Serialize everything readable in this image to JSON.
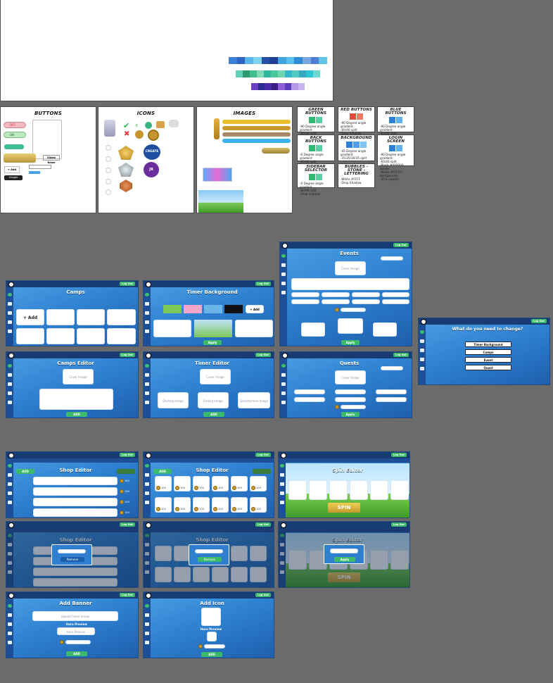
{
  "colors": {
    "canvas": "#6b6b6b",
    "palette_row1": [
      "#3a7fd8",
      "#2f63c4",
      "#5ab6e8",
      "#7fd2f0",
      "#2a4fa8",
      "#1e3f96",
      "#3fa3dd",
      "#56c0ee",
      "#2f8bd6",
      "#7aa5e0",
      "#4f7ed6",
      "#5fc4e6"
    ],
    "palette_row2": [
      "#5ed1b8",
      "#2e9a6e",
      "#3fbf8f",
      "#7fdcb4",
      "#2fb8a0",
      "#48c79c",
      "#6fd7ae",
      "#32b6c8",
      "#53cbbf",
      "#35a9c0",
      "#2dc5d4",
      "#6ed9d1"
    ],
    "palette_row3": [
      "#6a3fc4",
      "#2a2d8e",
      "#4b2aa8",
      "#3a1f82",
      "#8c5fd8",
      "#5a3cb8",
      "#b49ae6",
      "#c8b6ee"
    ]
  },
  "sheets": {
    "buttons": {
      "title": "BUTTONS",
      "toggle_off": "OFF",
      "toggle_on": "ON",
      "global_name": "Global Name",
      "add": "+ Add",
      "google": "Google"
    },
    "icons": {
      "title": "ICONS",
      "create": "CREATE",
      "jr": "JR"
    },
    "images": {
      "title": "IMAGES"
    }
  },
  "notes": [
    {
      "title": "GREEN BUTTONS",
      "lines": [
        "-90 Degree angle gradient",
        "-60/40 split",
        "-Drop Shadow"
      ],
      "swatches": [
        "#2fb870",
        "#5ad1a0"
      ]
    },
    {
      "title": "RED BUTTONS",
      "lines": [
        "-90 Degree angle gradient",
        "-60/40 split",
        "-Drop Shadow"
      ],
      "swatches": [
        "#e24c3f",
        "#f07a6a"
      ]
    },
    {
      "title": "BLUE BUTTONS",
      "lines": [
        "-90 Degree angle gradient",
        "-60/40 split",
        "-Drop Shadow"
      ],
      "swatches": [
        "#2f7fd8",
        "#5fb2ee"
      ]
    },
    {
      "title": "BACK BUTTONS",
      "lines": [
        "-0 Degree angle gradient",
        "-60/40 split",
        "-Drop Shadow"
      ],
      "swatches": [
        "#2fb870",
        "#5ad1a0"
      ]
    },
    {
      "title": "BACKGROUND",
      "lines": [
        "-45 Degree angle gradient",
        "-35/35/30/35 split"
      ],
      "swatches": [
        "#2f7fd8",
        "#4fa0e6",
        "#7fc4f2"
      ]
    },
    {
      "title": "LOGIN SCREEN",
      "lines": [
        "-90 Degree angle gradient",
        "-60/40 split",
        "-Black #000000 border",
        "-White #FFFFFF background",
        "-25% opacity"
      ],
      "swatches": [
        "#2f7fd8",
        "#5fb2ee"
      ]
    },
    {
      "title": "SIDEBAR SELECTOR",
      "lines": [
        "-0 Degree angle gradient",
        "-60/40 split",
        "-Drop shadow"
      ],
      "swatches": [
        "#2fb870",
        "#5ad1a0"
      ]
    },
    {
      "title": "BUBBLES - STONE - LETTERING",
      "lines": [
        "-White #FFFF",
        "-Drop Shadow"
      ],
      "swatches": []
    }
  ],
  "common": {
    "logout": "Log Out",
    "apply": "Apply",
    "add": "Add"
  },
  "screens": {
    "camps": {
      "title": "Camps",
      "add": "+ Add"
    },
    "timer_bg": {
      "title": "Timer Background",
      "add": "+ Add",
      "apply": "Apply"
    },
    "events": {
      "title": "Events",
      "cover": "Cover Image",
      "desc": "Description",
      "spin": "Spin & Prizes",
      "apply": "Apply"
    },
    "change": {
      "title": "What do you need to change?",
      "options": [
        "Timer Background",
        "Camps",
        "Event",
        "Quest"
      ]
    },
    "camps_editor": {
      "title": "Camps Editor",
      "cover": "Cover Image",
      "desc": "Description",
      "add": "ADD"
    },
    "timer_editor": {
      "title": "Timer Editor",
      "cover": "Cover Image",
      "opt1": "Starting Image",
      "opt2": "Ending Image",
      "opt3": "Splashscreen Image",
      "add": "ADD"
    },
    "quests": {
      "title": "Quests",
      "cover": "Cover Image",
      "apply": "Apply"
    },
    "shop1": {
      "title": "Shop Editor",
      "add": "ADD",
      "price": "100"
    },
    "shop2": {
      "title": "Shop Editor",
      "add": "ADD",
      "price": "100"
    },
    "spin1": {
      "title": "Spin Editor",
      "spin": "SPIN"
    },
    "shop3": {
      "title": "Shop Editor",
      "remove": "Remove"
    },
    "shop4": {
      "title": "Shop Editor",
      "remove": "Remove"
    },
    "spin2": {
      "title": "Spin Editor",
      "spin": "SPIN",
      "apply": "Apply"
    },
    "add_banner": {
      "title": "Add Banner",
      "upload": "Upload Cover Image",
      "preview_label": "Hero Preview",
      "preview": "Hero Preview",
      "add": "ADD"
    },
    "add_icon": {
      "title": "Add Icon",
      "preview_label": "Hero Preview",
      "add": "ADD"
    }
  }
}
